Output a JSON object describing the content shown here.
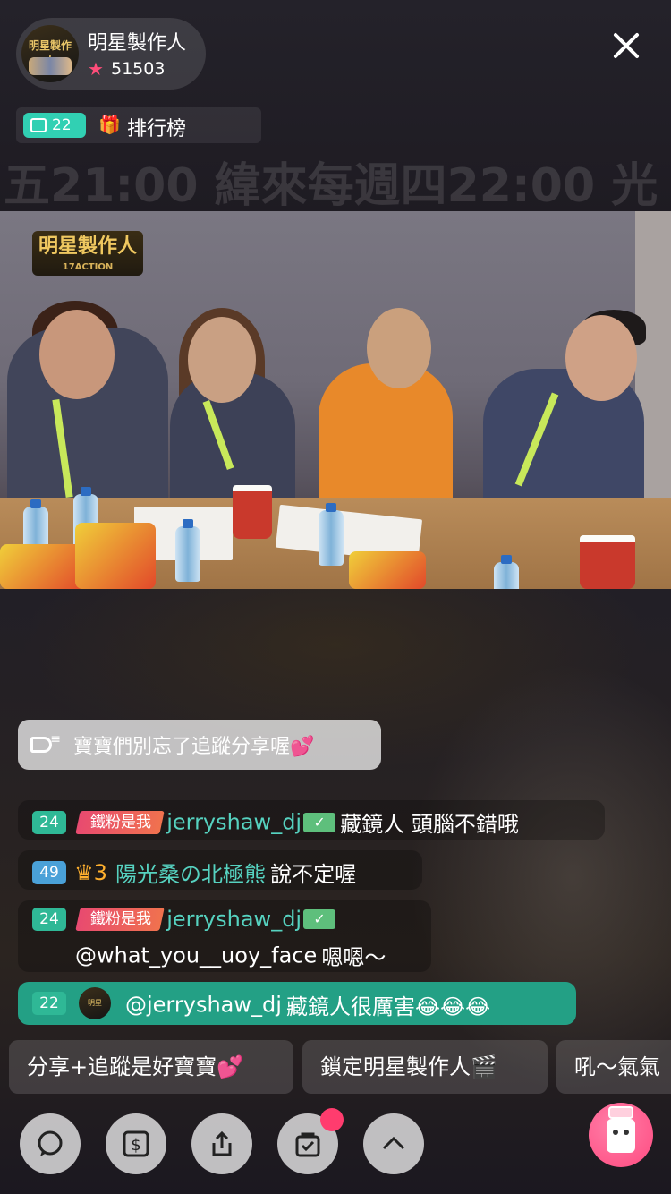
{
  "host": {
    "name": "明星製作人",
    "stars": "51503",
    "avatar_logo": "明星製作人"
  },
  "badges": {
    "gift_count": "22",
    "ranking_label": "排行榜"
  },
  "background_banner": "五21:00 緯來每週四22:00 光",
  "video": {
    "logo_text": "明星製作人",
    "logo_sub": "17ACTION"
  },
  "notice": {
    "text": "寶寶們別忘了追蹤分享喔💕"
  },
  "chat": [
    {
      "level": "24",
      "fan_badge": "鐵粉是我",
      "user": "jerryshaw_dj",
      "verified": "✓",
      "text": "藏鏡人 頭腦不錯哦"
    },
    {
      "level": "49",
      "crown": "♛3",
      "user": "陽光桑の北極熊",
      "text": "說不定喔"
    },
    {
      "level": "24",
      "fan_badge": "鐵粉是我",
      "user": "jerryshaw_dj",
      "verified": "✓",
      "text_user": "@what_you__uoy_face",
      "text": "嗯嗯～"
    }
  ],
  "highlight": {
    "level": "22",
    "user": "@jerryshaw_dj",
    "text": "藏鏡人很厲害😂😂😂"
  },
  "quick_replies": [
    "分享+追蹤是好寶寶💕",
    "鎖定明星製作人🎬",
    "吼～氣氣"
  ],
  "toolbar": {
    "icons": [
      "chat-icon",
      "money-icon",
      "share-icon",
      "shopping-bag-icon",
      "chevron-up-icon",
      "gift-icon"
    ]
  },
  "colors": {
    "accent_teal": "#31d0b3",
    "highlight_bg": "#23a085",
    "username": "#56d2c0",
    "notification_dot": "#ff3c6e",
    "star": "#ff4d7a"
  }
}
